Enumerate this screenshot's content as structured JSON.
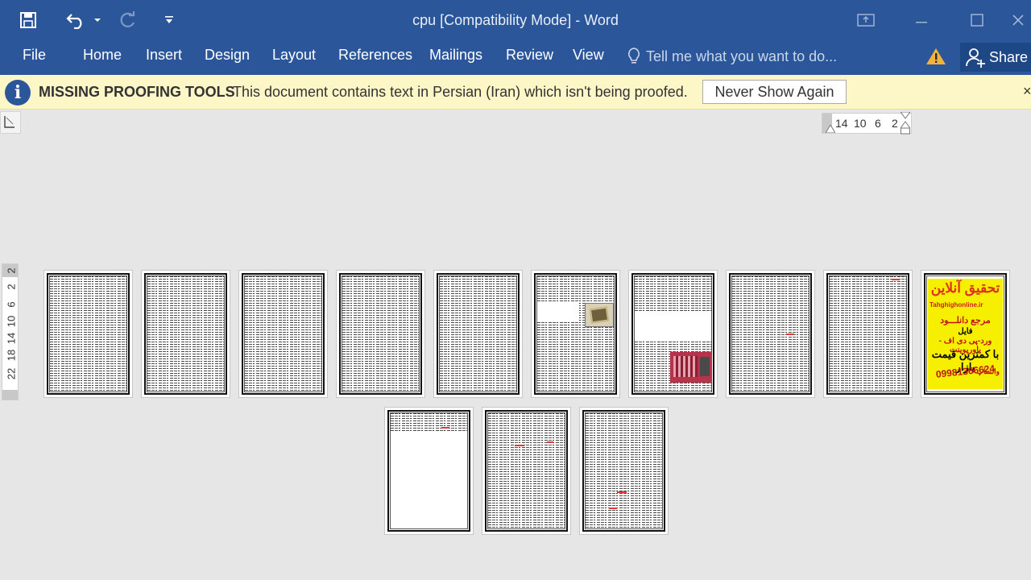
{
  "window": {
    "title": "cpu [Compatibility Mode] - Word"
  },
  "ribbon": {
    "tabs": [
      "File",
      "Home",
      "Insert",
      "Design",
      "Layout",
      "References",
      "Mailings",
      "Review",
      "View"
    ],
    "tell_me_placeholder": "Tell me what you want to do...",
    "share_label": "Share"
  },
  "message_bar": {
    "title": "MISSING PROOFING TOOLS",
    "text": "This document contains text in Persian (Iran) which isn't being proofed.",
    "button_label": "Never Show Again",
    "close_glyph": "×"
  },
  "horizontal_ruler": {
    "labels": [
      "14",
      "10",
      "6",
      "2"
    ]
  },
  "vertical_ruler": {
    "labels": [
      "2",
      "2",
      "6",
      "10",
      "14",
      "18",
      "22"
    ]
  },
  "document": {
    "page_count": 13,
    "ad_page": {
      "line1": "تحقیق آنلاین",
      "line2": "Tahghighonline.ir",
      "line3": "مرجع دانلـــود",
      "line4": "فایل",
      "line5": "ورد-پی دی اف - پاورپوینت",
      "line6": "با کمترین قیمت بازار",
      "line7": "09981366624",
      "line8": "واتساپ"
    }
  },
  "colors": {
    "title_bar": "#2b579a",
    "message_bar": "#fdf6c7",
    "canvas": "#e6e6e6",
    "ad_background": "#f7ef00"
  }
}
